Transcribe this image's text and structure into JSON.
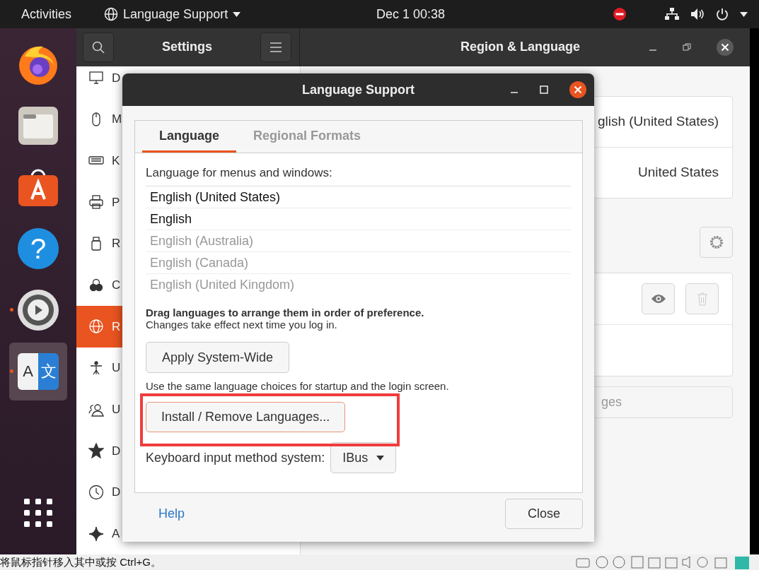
{
  "top_bar": {
    "activities": "Activities",
    "app_menu": "Language Support",
    "clock": "Dec 1  00:38"
  },
  "dock": [
    {
      "kind": "firefox",
      "running": false,
      "selected": false
    },
    {
      "kind": "files",
      "running": false,
      "selected": false
    },
    {
      "kind": "software",
      "running": false,
      "selected": false
    },
    {
      "kind": "help",
      "running": false,
      "selected": false,
      "label": "?"
    },
    {
      "kind": "settings",
      "running": true,
      "selected": false
    },
    {
      "kind": "language",
      "running": true,
      "selected": true,
      "label_a": "A",
      "label_b": "文"
    },
    {
      "kind": "apps",
      "running": false,
      "selected": false
    }
  ],
  "settings_window": {
    "title": "Settings",
    "panel_title": "Region & Language",
    "sidebar": [
      {
        "kind": "display",
        "label": "D",
        "selected": false
      },
      {
        "kind": "mouse",
        "label": "M",
        "selected": false
      },
      {
        "kind": "keyboard",
        "label": "K",
        "selected": false
      },
      {
        "kind": "printer",
        "label": "P",
        "selected": false
      },
      {
        "kind": "usb",
        "label": "R",
        "selected": false
      },
      {
        "kind": "color",
        "label": "C",
        "selected": false
      },
      {
        "kind": "globe",
        "label": "R",
        "selected": true
      },
      {
        "kind": "person",
        "label": "U",
        "selected": false
      },
      {
        "kind": "users",
        "label": "U",
        "selected": false
      },
      {
        "kind": "star",
        "label": "D",
        "selected": false
      },
      {
        "kind": "clock",
        "label": "D",
        "selected": false
      },
      {
        "kind": "sparkle",
        "label": "A",
        "selected": false
      }
    ],
    "rows": [
      "glish (United States)",
      "United States"
    ],
    "manage_field": "ges"
  },
  "dialog": {
    "title": "Language Support",
    "tabs": [
      {
        "label": "Language",
        "selected": true
      },
      {
        "label": "Regional Formats",
        "selected": false
      }
    ],
    "list_label": "Language for menus and windows:",
    "languages": [
      {
        "name": "English (United States)",
        "enabled": true
      },
      {
        "name": "English",
        "enabled": true
      },
      {
        "name": "English (Australia)",
        "enabled": false
      },
      {
        "name": "English (Canada)",
        "enabled": false
      },
      {
        "name": "English (United Kingdom)",
        "enabled": false
      }
    ],
    "drag_hint": "Drag languages to arrange them in order of preference.",
    "change_note": "Changes take effect next time you log in.",
    "apply_button": "Apply System-Wide",
    "use_note": "Use the same language choices for startup and the login screen.",
    "install_button": {
      "label": "Install / Remove Languages...",
      "highlighted": true
    },
    "keyboard_label": "Keyboard input method system:",
    "keyboard_value": "IBus",
    "help_link": "Help",
    "close_button": "Close"
  },
  "status_bar": {
    "text": "将鼠标指针移入其中或按 Ctrl+G。"
  }
}
